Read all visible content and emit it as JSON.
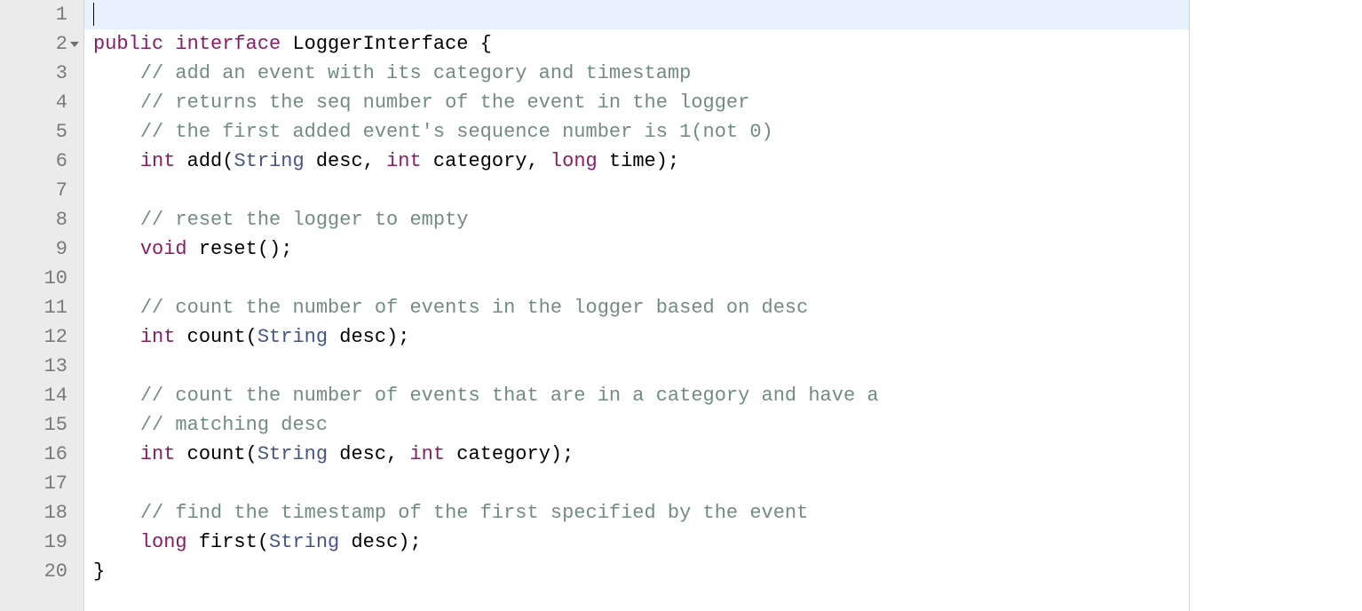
{
  "gutter": {
    "lines": [
      "1",
      "2",
      "3",
      "4",
      "5",
      "6",
      "7",
      "8",
      "9",
      "10",
      "11",
      "12",
      "13",
      "14",
      "15",
      "16",
      "17",
      "18",
      "19",
      "20"
    ],
    "foldable_line_index": 1
  },
  "code": {
    "active_line_index": 0,
    "lines": [
      {
        "tokens": []
      },
      {
        "tokens": [
          {
            "cls": "tok-kw",
            "t": "public"
          },
          {
            "cls": "",
            "t": " "
          },
          {
            "cls": "tok-kw",
            "t": "interface"
          },
          {
            "cls": "",
            "t": " "
          },
          {
            "cls": "",
            "t": "LoggerInterface "
          },
          {
            "cls": "tok-paren",
            "t": "{"
          }
        ]
      },
      {
        "tokens": [
          {
            "cls": "",
            "t": "    "
          },
          {
            "cls": "tok-comment",
            "t": "// add an event with its category and timestamp"
          }
        ]
      },
      {
        "tokens": [
          {
            "cls": "",
            "t": "    "
          },
          {
            "cls": "tok-comment",
            "t": "// returns the seq number of the event in the logger"
          }
        ]
      },
      {
        "tokens": [
          {
            "cls": "",
            "t": "    "
          },
          {
            "cls": "tok-comment",
            "t": "// the first added event's sequence number is 1(not 0)"
          }
        ]
      },
      {
        "tokens": [
          {
            "cls": "",
            "t": "    "
          },
          {
            "cls": "tok-kw",
            "t": "int"
          },
          {
            "cls": "",
            "t": " add"
          },
          {
            "cls": "tok-paren",
            "t": "("
          },
          {
            "cls": "tok-type",
            "t": "String"
          },
          {
            "cls": "",
            "t": " desc"
          },
          {
            "cls": "tok-paren",
            "t": ","
          },
          {
            "cls": "",
            "t": " "
          },
          {
            "cls": "tok-kw",
            "t": "int"
          },
          {
            "cls": "",
            "t": " category"
          },
          {
            "cls": "tok-paren",
            "t": ","
          },
          {
            "cls": "",
            "t": " "
          },
          {
            "cls": "tok-kw",
            "t": "long"
          },
          {
            "cls": "",
            "t": " time"
          },
          {
            "cls": "tok-paren",
            "t": ");"
          }
        ]
      },
      {
        "tokens": []
      },
      {
        "tokens": [
          {
            "cls": "",
            "t": "    "
          },
          {
            "cls": "tok-comment",
            "t": "// reset the logger to empty"
          }
        ]
      },
      {
        "tokens": [
          {
            "cls": "",
            "t": "    "
          },
          {
            "cls": "tok-kw",
            "t": "void"
          },
          {
            "cls": "",
            "t": " reset"
          },
          {
            "cls": "tok-paren",
            "t": "();"
          }
        ]
      },
      {
        "tokens": []
      },
      {
        "tokens": [
          {
            "cls": "",
            "t": "    "
          },
          {
            "cls": "tok-comment",
            "t": "// count the number of events in the logger based on desc"
          }
        ]
      },
      {
        "tokens": [
          {
            "cls": "",
            "t": "    "
          },
          {
            "cls": "tok-kw",
            "t": "int"
          },
          {
            "cls": "",
            "t": " count"
          },
          {
            "cls": "tok-paren",
            "t": "("
          },
          {
            "cls": "tok-type",
            "t": "String"
          },
          {
            "cls": "",
            "t": " desc"
          },
          {
            "cls": "tok-paren",
            "t": ");"
          }
        ]
      },
      {
        "tokens": []
      },
      {
        "tokens": [
          {
            "cls": "",
            "t": "    "
          },
          {
            "cls": "tok-comment",
            "t": "// count the number of events that are in a category and have a"
          }
        ]
      },
      {
        "tokens": [
          {
            "cls": "",
            "t": "    "
          },
          {
            "cls": "tok-comment",
            "t": "// matching desc"
          }
        ]
      },
      {
        "tokens": [
          {
            "cls": "",
            "t": "    "
          },
          {
            "cls": "tok-kw",
            "t": "int"
          },
          {
            "cls": "",
            "t": " count"
          },
          {
            "cls": "tok-paren",
            "t": "("
          },
          {
            "cls": "tok-type",
            "t": "String"
          },
          {
            "cls": "",
            "t": " desc"
          },
          {
            "cls": "tok-paren",
            "t": ","
          },
          {
            "cls": "",
            "t": " "
          },
          {
            "cls": "tok-kw",
            "t": "int"
          },
          {
            "cls": "",
            "t": " category"
          },
          {
            "cls": "tok-paren",
            "t": ");"
          }
        ]
      },
      {
        "tokens": []
      },
      {
        "tokens": [
          {
            "cls": "",
            "t": "    "
          },
          {
            "cls": "tok-comment",
            "t": "// find the timestamp of the first specified by the event"
          }
        ]
      },
      {
        "tokens": [
          {
            "cls": "",
            "t": "    "
          },
          {
            "cls": "tok-kw",
            "t": "long"
          },
          {
            "cls": "",
            "t": " first"
          },
          {
            "cls": "tok-paren",
            "t": "("
          },
          {
            "cls": "tok-type",
            "t": "String"
          },
          {
            "cls": "",
            "t": " desc"
          },
          {
            "cls": "tok-paren",
            "t": ");"
          }
        ]
      },
      {
        "tokens": [
          {
            "cls": "tok-paren",
            "t": "}"
          }
        ]
      }
    ]
  }
}
